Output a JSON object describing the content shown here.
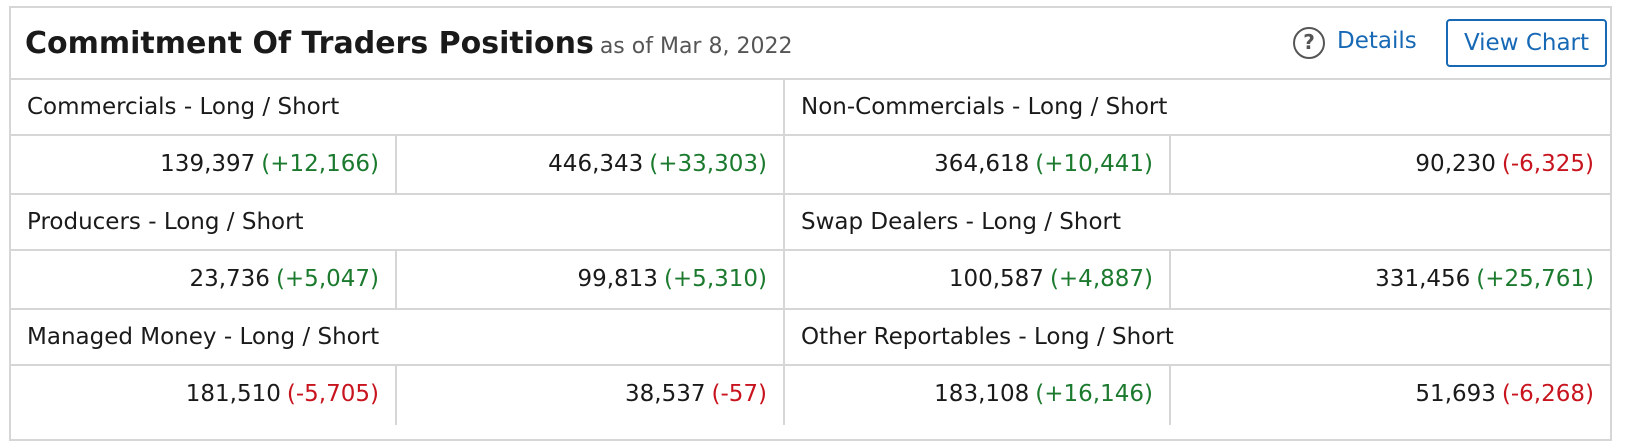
{
  "header": {
    "title": "Commitment Of Traders Positions",
    "as_of": "as of Mar 8, 2022",
    "help_icon": "question-circle-icon",
    "details_label": "Details",
    "view_chart_label": "View Chart"
  },
  "colors": {
    "positive": "#1b7a2e",
    "negative": "#c8141e",
    "link": "#1769b5",
    "border": "#d6d6d6"
  },
  "groups": [
    {
      "label": "Commercials - Long / Short",
      "long": {
        "value": "139,397",
        "change": "(+12,166)"
      },
      "short": {
        "value": "446,343",
        "change": "(+33,303)"
      }
    },
    {
      "label": "Non-Commercials - Long / Short",
      "long": {
        "value": "364,618",
        "change": "(+10,441)"
      },
      "short": {
        "value": "90,230",
        "change": "(-6,325)"
      }
    },
    {
      "label": "Producers - Long / Short",
      "long": {
        "value": "23,736",
        "change": "(+5,047)"
      },
      "short": {
        "value": "99,813",
        "change": "(+5,310)"
      }
    },
    {
      "label": "Swap Dealers - Long / Short",
      "long": {
        "value": "100,587",
        "change": "(+4,887)"
      },
      "short": {
        "value": "331,456",
        "change": "(+25,761)"
      }
    },
    {
      "label": "Managed Money - Long / Short",
      "long": {
        "value": "181,510",
        "change": "(-5,705)"
      },
      "short": {
        "value": "38,537",
        "change": "(-57)"
      }
    },
    {
      "label": "Other Reportables - Long / Short",
      "long": {
        "value": "183,108",
        "change": "(+16,146)"
      },
      "short": {
        "value": "51,693",
        "change": "(-6,268)"
      }
    }
  ]
}
